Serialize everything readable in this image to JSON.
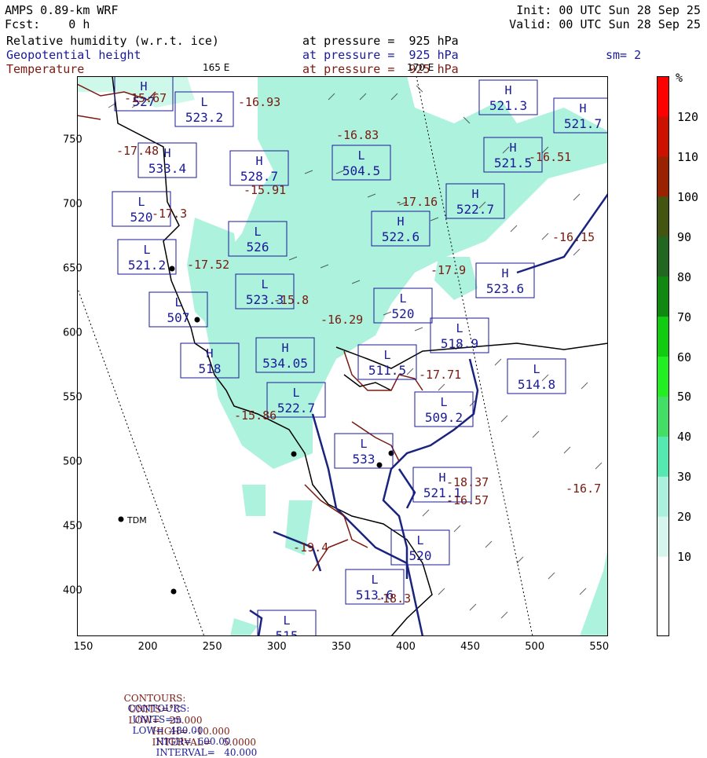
{
  "header": {
    "model": "AMPS 0.89-km WRF",
    "forecast": "Fcst:    0 h",
    "init": "Init: 00 UTC Sun 28 Sep 25",
    "valid": "Valid: 00 UTC Sun 28 Sep 25",
    "smoothing": "sm= 2"
  },
  "fields": [
    {
      "name": "Relative humidity (w.r.t. ice)",
      "level": "at pressure =  925 hPa",
      "color": "#000000"
    },
    {
      "name": "Geopotential height",
      "level": "at pressure =  925 hPa",
      "color": "#1a1a9a"
    },
    {
      "name": "Temperature",
      "level": "at pressure =  925 hPa",
      "color": "#7a1a10"
    }
  ],
  "map_labels": {
    "lon_165e": "165 E",
    "lon_170e": "170 E",
    "station": "TDM"
  },
  "axes": {
    "x_ticks": [
      "150",
      "200",
      "250",
      "300",
      "350",
      "400",
      "450",
      "500",
      "550"
    ],
    "y_ticks": [
      "750",
      "700",
      "650",
      "600",
      "550",
      "500",
      "450",
      "400"
    ]
  },
  "colorbar": {
    "unit": "%",
    "ticks": [
      "120",
      "110",
      "100",
      "90",
      "80",
      "70",
      "60",
      "50",
      "40",
      "30",
      "20",
      "10"
    ],
    "colors": [
      "#ffffff",
      "#ffffff",
      "#d6f5ec",
      "#aaf0dc",
      "#55e8b0",
      "#44dd66",
      "#22ee22",
      "#11cc11",
      "#118811",
      "#226622",
      "#445511",
      "#992200",
      "#cc1100",
      "#ff0000"
    ]
  },
  "footer": {
    "line1": {
      "prefix": "CONTOURS:",
      "units": "UNITS=°C",
      "low": "LOW=  -25.000",
      "high": "HIGH=  -10.000",
      "interval": "INTERVAL=    5.0000"
    },
    "line2": {
      "prefix": "CONTOURS:",
      "units": "UNITS=m",
      "low": "LOW=  480.00",
      "high": "HIGH=  600.00",
      "interval": "INTERVAL=   40.000"
    }
  },
  "height_boxes": [
    {
      "hl": "L",
      "value": "523.2"
    },
    {
      "hl": "H",
      "value": "521.3"
    },
    {
      "hl": "H",
      "value": "521.7"
    },
    {
      "hl": "H",
      "value": "533.4"
    },
    {
      "hl": "H",
      "value": "528.7"
    },
    {
      "hl": "L",
      "value": "504.5"
    },
    {
      "hl": "H",
      "value": "521.5"
    },
    {
      "hl": "L",
      "value": "520"
    },
    {
      "hl": "H",
      "value": "522.7"
    },
    {
      "hl": "H",
      "value": "522.6"
    },
    {
      "hl": "L",
      "value": "526"
    },
    {
      "hl": "L",
      "value": "521.2"
    },
    {
      "hl": "L",
      "value": "523.3"
    },
    {
      "hl": "H",
      "value": "523.6"
    },
    {
      "hl": "L",
      "value": "507"
    },
    {
      "hl": "L",
      "value": "520"
    },
    {
      "hl": "L",
      "value": "518.9"
    },
    {
      "hl": "H",
      "value": "518"
    },
    {
      "hl": "H",
      "value": "534.05"
    },
    {
      "hl": "L",
      "value": "511.5"
    },
    {
      "hl": "L",
      "value": "514.8"
    },
    {
      "hl": "L",
      "value": "522.7"
    },
    {
      "hl": "L",
      "value": "509.2"
    },
    {
      "hl": "L",
      "value": "533"
    },
    {
      "hl": "H",
      "value": "521.1"
    },
    {
      "hl": "L",
      "value": "520"
    },
    {
      "hl": "L",
      "value": "513.6"
    },
    {
      "hl": "L",
      "value": "515"
    },
    {
      "hl": "H",
      "value": "527"
    }
  ],
  "temp_labels": [
    "-15.67",
    "-16.93",
    "-16.83",
    "-17.48",
    "-15.91",
    "-17.16",
    "-17.3",
    "-16.51",
    "-16.15",
    "-17.52",
    "-17.9",
    "-16.29",
    "-15.8",
    "-17.71",
    "-15.86",
    "-18.37",
    "-16.57",
    "-19.4",
    "-18.3",
    "-16.7"
  ]
}
